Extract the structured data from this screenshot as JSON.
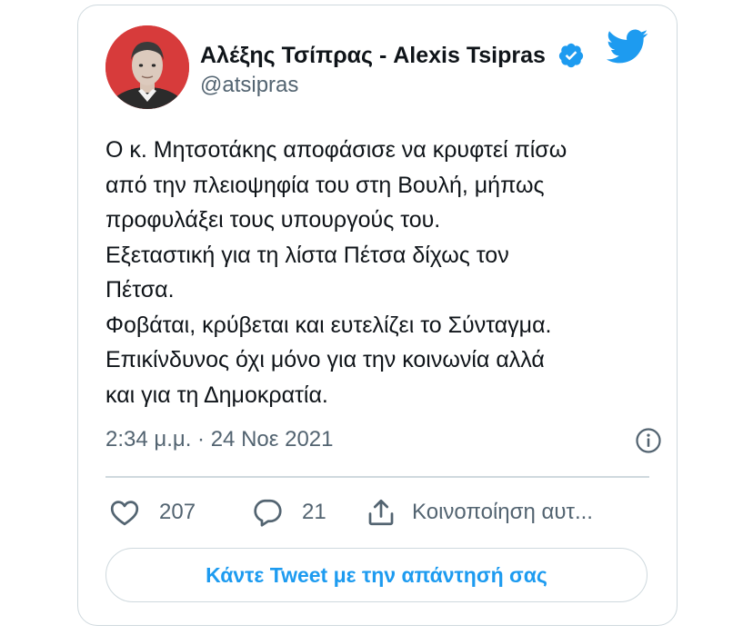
{
  "author": {
    "display_name": "Αλέξης Τσίπρας - Alexis Tsipras",
    "handle": "@atsipras",
    "avatar_icon": "person-avatar",
    "verified_icon": "verified-badge-icon",
    "verified_color": "#1d9bf0"
  },
  "platform_icon": "twitter-bird-icon",
  "brand_color": "#1d9bf0",
  "tweet": {
    "lines": [
      "Ο κ. Μητσοτάκης αποφάσισε να κρυφτεί πίσω",
      "από την πλειοψηφία του στη Βουλή, μήπως",
      "προφυλάξει τους υπουργούς του.",
      "Εξεταστική για τη λίστα Πέτσα δίχως τον",
      "Πέτσα.",
      "Φοβάται, κρύβεται και ευτελίζει το Σύνταγμα.",
      "Επικίνδυνος όχι μόνο για την κοινωνία αλλά",
      "και για τη Δημοκρατία."
    ],
    "timestamp": "2:34 μ.μ. · 24 Νοε 2021"
  },
  "actions": {
    "like_count": "207",
    "reply_count": "21",
    "share_label": "Κοινοποίηση αυτ..."
  },
  "reply_button_label": "Κάντε Tweet με την απάντησή σας"
}
